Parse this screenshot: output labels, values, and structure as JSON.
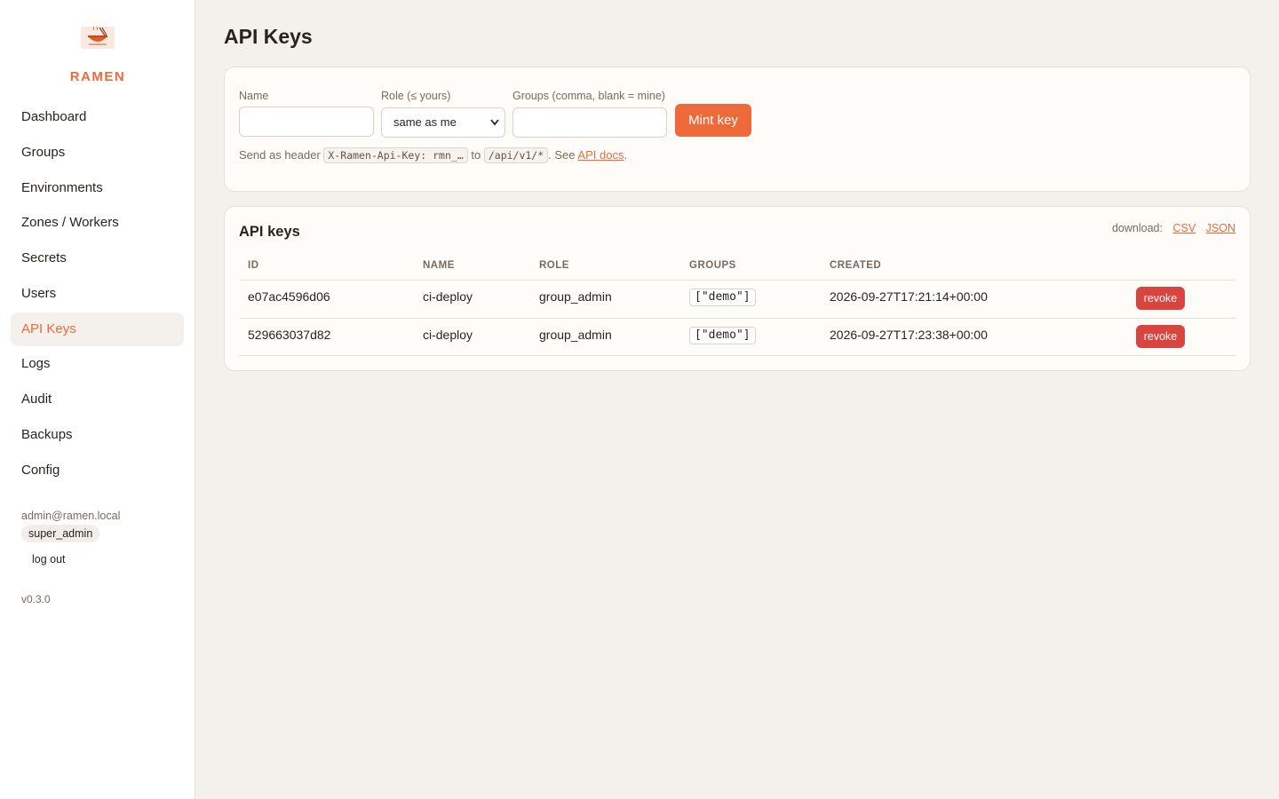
{
  "brand": {
    "name": "RAMEN"
  },
  "nav": [
    {
      "label": "Dashboard",
      "active": false
    },
    {
      "label": "Groups",
      "active": false
    },
    {
      "label": "Environments",
      "active": false
    },
    {
      "label": "Zones / Workers",
      "active": false
    },
    {
      "label": "Secrets",
      "active": false
    },
    {
      "label": "Users",
      "active": false
    },
    {
      "label": "API Keys",
      "active": true
    },
    {
      "label": "Logs",
      "active": false
    },
    {
      "label": "Audit",
      "active": false
    },
    {
      "label": "Backups",
      "active": false
    },
    {
      "label": "Config",
      "active": false
    }
  ],
  "user": {
    "email": "admin@ramen.local",
    "role": "super_admin",
    "logout_label": "log out"
  },
  "version": "v0.3.0",
  "page": {
    "title": "API Keys"
  },
  "form": {
    "name_label": "Name",
    "name_value": "",
    "role_label": "Role (≤ yours)",
    "role_selected": "same as me",
    "groups_label": "Groups (comma, blank = mine)",
    "groups_value": "",
    "submit_label": "Mint key",
    "hint": {
      "prefix": "Send as header",
      "header_code": "X-Ramen-Api-Key: rmn_…",
      "to": "to",
      "path_code": "/api/v1/*",
      "see": ". See",
      "docs_link": "API docs",
      "end": "."
    }
  },
  "keys": {
    "title": "API keys",
    "download_label": "download:",
    "csv_label": "CSV",
    "json_label": "JSON",
    "columns": [
      "ID",
      "NAME",
      "ROLE",
      "GROUPS",
      "CREATED"
    ],
    "rows": [
      {
        "id": "e07ac4596d06",
        "name": "ci-deploy",
        "role": "group_admin",
        "groups": "[\"demo\"]",
        "created": "2026-09-27T17:21:14+00:00",
        "action": "revoke"
      },
      {
        "id": "529663037d82",
        "name": "ci-deploy",
        "role": "group_admin",
        "groups": "[\"demo\"]",
        "created": "2026-09-27T17:23:38+00:00",
        "action": "revoke"
      }
    ]
  },
  "colors": {
    "accent": "#ee6a3a",
    "danger": "#d9453e",
    "background": "#f4f1ec"
  },
  "icons": {
    "logo": "ramen-bowl-logo-icon",
    "select": "chevron-down-icon"
  }
}
